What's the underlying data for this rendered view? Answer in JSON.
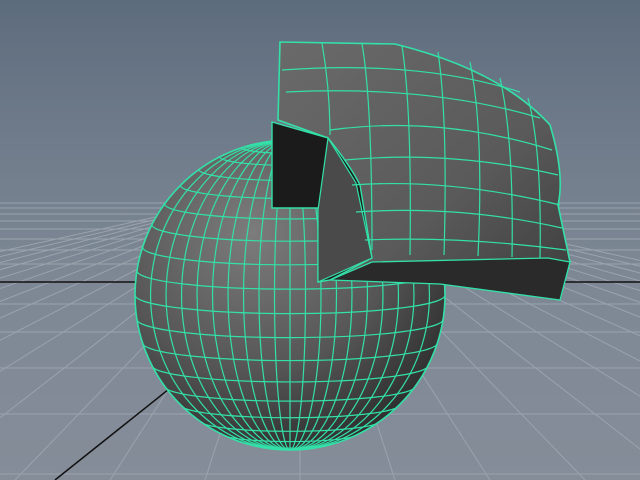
{
  "viewport": {
    "view": "perspective",
    "background_color": "#6e7b8b",
    "grid": {
      "visible": true,
      "line_color": "#9aa3ae",
      "axis_color": "#111111"
    }
  },
  "scene": {
    "objects": [
      {
        "type": "polygon-sphere",
        "state": "selected",
        "wireframe_color": "#33e0a8",
        "shading": "smooth-gray"
      },
      {
        "type": "extruded-face-shell",
        "state": "selected",
        "wireframe_color": "#33e0a8",
        "shading": "smooth-gray"
      }
    ]
  }
}
